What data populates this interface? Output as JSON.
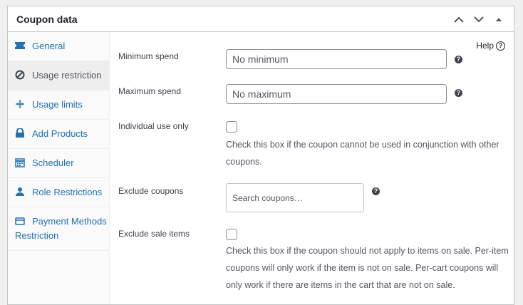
{
  "panel": {
    "title": "Coupon data",
    "controls": [
      "chevron-up-icon",
      "chevron-down-icon",
      "triangle-up-icon"
    ]
  },
  "sidebar": {
    "items": [
      {
        "label": "General",
        "icon": "ticket-icon",
        "active": false
      },
      {
        "label": "Usage restriction",
        "icon": "block-icon",
        "active": true
      },
      {
        "label": "Usage limits",
        "icon": "crosshair-icon",
        "active": false
      },
      {
        "label": "Add Products",
        "icon": "lock-icon",
        "active": false
      },
      {
        "label": "Scheduler",
        "icon": "calendar-icon",
        "active": false
      },
      {
        "label": "Role Restrictions",
        "icon": "person-icon",
        "active": false
      },
      {
        "label": "Payment Methods Restriction",
        "icon": "card-icon",
        "active": false
      }
    ]
  },
  "help": {
    "label": "Help"
  },
  "fields": {
    "minimum_spend": {
      "label": "Minimum spend",
      "placeholder": "No minimum"
    },
    "maximum_spend": {
      "label": "Maximum spend",
      "placeholder": "No maximum"
    },
    "individual_use": {
      "label": "Individual use only",
      "description": "Check this box if the coupon cannot be used in conjunction with other coupons."
    },
    "exclude_coupons": {
      "label": "Exclude coupons",
      "placeholder": "Search coupons…"
    },
    "exclude_sale": {
      "label": "Exclude sale items",
      "description": "Check this box if the coupon should not apply to items on sale. Per-item coupons will only work if the item is not on sale. Per-cart coupons will only work if there are items in the cart that are not on sale."
    }
  },
  "colors": {
    "link": "#2271b1",
    "border": "#c3c4c7",
    "text": "#3c434a"
  }
}
